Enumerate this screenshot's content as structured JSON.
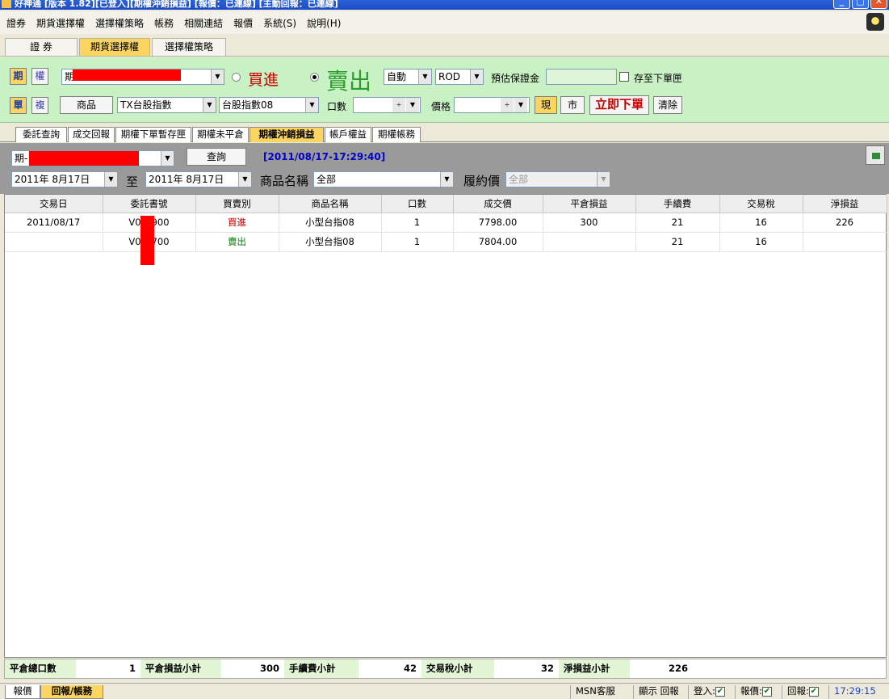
{
  "window": {
    "title": "好神通 [版本 1.82][已登入][期權沖銷損益] [報價：已連線] [主動回報：已連線]"
  },
  "menu": [
    "證券",
    "期貨選擇權",
    "選擇權策略",
    "帳務",
    "相關連結",
    "報價",
    "系統(S)",
    "說明(H)"
  ],
  "main_tabs": [
    "證 券",
    "期貨選擇權",
    "選擇權策略"
  ],
  "order": {
    "type_fut": "期",
    "type_opt": "權",
    "account_prefix": "期",
    "buy_label": "買進",
    "sell_label": "賣出",
    "auto": "自動",
    "rod": "ROD",
    "margin_label": "預估保證金",
    "margin_value": "",
    "save_label": "存至下單匣",
    "single": "單",
    "compound": "複",
    "product_btn": "商品",
    "commodity": "TX台股指數",
    "contract": "台股指數08",
    "qty_label": "口數",
    "qty_value": "",
    "price_label": "價格",
    "price_value": "",
    "current_btn": "現",
    "market_btn": "市",
    "submit": "立即下單",
    "clear": "清除"
  },
  "sub_tabs": [
    "委託查詢",
    "成交回報",
    "期權下單暫存匣",
    "期權未平倉",
    "期權沖銷損益",
    "帳戶權益",
    "期權帳務"
  ],
  "query": {
    "account_prefix": "期-",
    "query_btn": "查詢",
    "timestamp": "[2011/08/17-17:29:40]",
    "date_from": "2011年  8月17日",
    "to_label": "至",
    "date_to": "2011年  8月17日",
    "product_name_label": "商品名稱",
    "product_name_value": "全部",
    "strike_label": "履約價",
    "strike_value": "全部"
  },
  "table": {
    "columns": [
      "交易日",
      "委託書號",
      "買賣別",
      "商品名稱",
      "口數",
      "成交價",
      "平倉損益",
      "手續費",
      "交易稅",
      "淨損益"
    ],
    "rows": [
      {
        "date": "2011/08/17",
        "order": "V0",
        "order_tail": "900",
        "side": "買進",
        "product": "小型台指08",
        "qty": "1",
        "price": "7798.00",
        "pl": "300",
        "fee": "21",
        "tax": "16",
        "net": "226"
      },
      {
        "date": "",
        "order": "V0",
        "order_tail": "700",
        "side": "賣出",
        "product": "小型台指08",
        "qty": "1",
        "price": "7804.00",
        "pl": "",
        "fee": "21",
        "tax": "16",
        "net": ""
      }
    ]
  },
  "summary": {
    "qty_label": "平倉總口數",
    "qty": "1",
    "pl_label": "平倉損益小計",
    "pl": "300",
    "fee_label": "手續費小計",
    "fee": "42",
    "tax_label": "交易稅小計",
    "tax": "32",
    "net_label": "淨損益小計",
    "net": "226"
  },
  "status": {
    "tab_quote": "報價",
    "tab_report": "回報/帳務",
    "msn": "MSN客服",
    "show_report": "顯示 回報",
    "login": "登入:",
    "quote": "報價:",
    "report": "回報:",
    "time": "17:29:15"
  },
  "colors": {
    "accent_yellow": "#fbd55f",
    "panel_green": "#c9f2c4",
    "buy_red": "#c80000",
    "sell_green": "#008000"
  }
}
